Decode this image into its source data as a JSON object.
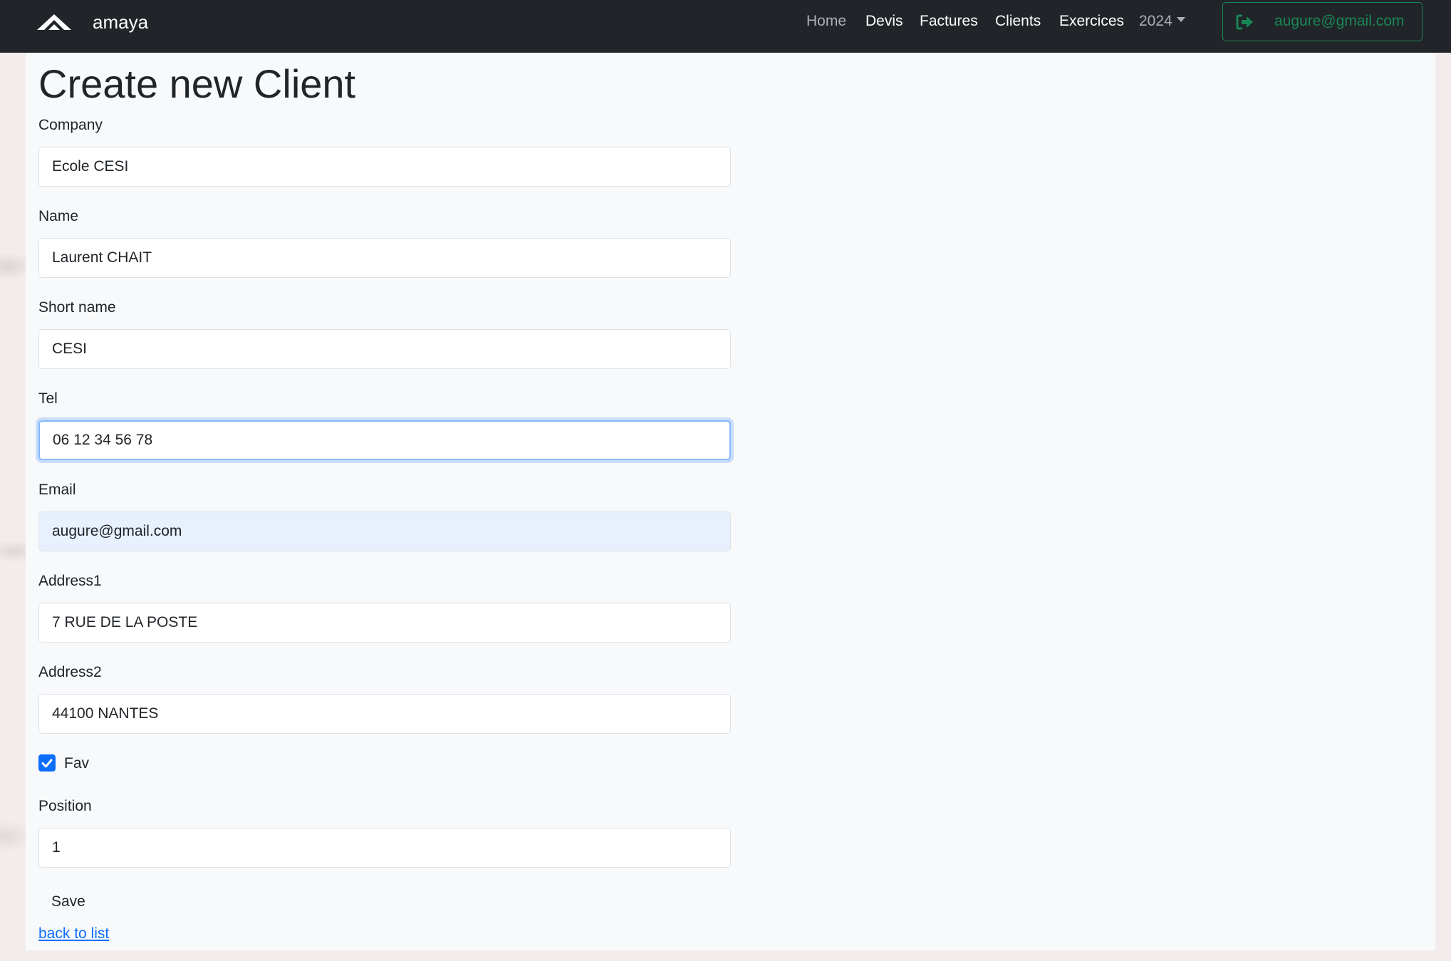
{
  "navbar": {
    "brand": "amaya",
    "links": [
      "Home",
      "Devis",
      "Factures",
      "Clients",
      "Exercices"
    ],
    "year": "2024",
    "user_email": "augure@gmail.com"
  },
  "page": {
    "title": "Create new Client"
  },
  "form": {
    "company_label": "Company",
    "company_value": "Ecole CESI",
    "name_label": "Name",
    "name_value": "Laurent CHAIT",
    "short_name_label": "Short name",
    "short_name_value": "CESI",
    "tel_label": "Tel",
    "tel_value": "06 12 34 56 78",
    "email_label": "Email",
    "email_value": "augure@gmail.com",
    "address1_label": "Address1",
    "address1_value": "7 RUE DE LA POSTE",
    "address2_label": "Address2",
    "address2_value": "44100 NANTES",
    "fav_label": "Fav",
    "fav_checked": true,
    "position_label": "Position",
    "position_value": "1",
    "save_label": "Save",
    "back_label": "back to list"
  }
}
